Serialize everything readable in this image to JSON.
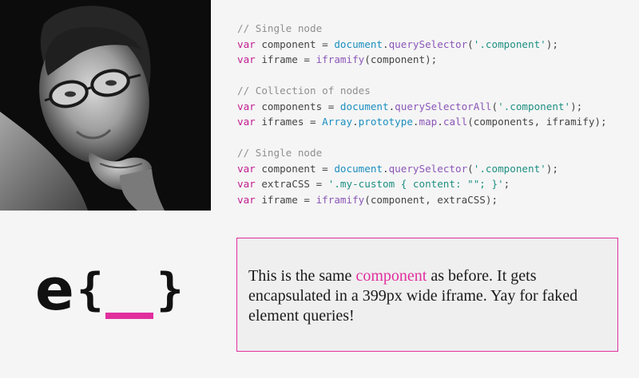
{
  "code": {
    "lines": [
      [
        {
          "t": "// Single node",
          "c": "comment"
        }
      ],
      [
        {
          "t": "var",
          "c": "keyword"
        },
        {
          "t": " component = ",
          "c": "plain"
        },
        {
          "t": "document",
          "c": "object"
        },
        {
          "t": ".",
          "c": "plain"
        },
        {
          "t": "querySelector",
          "c": "method"
        },
        {
          "t": "(",
          "c": "plain"
        },
        {
          "t": "'.component'",
          "c": "string"
        },
        {
          "t": ");",
          "c": "plain"
        }
      ],
      [
        {
          "t": "var",
          "c": "keyword"
        },
        {
          "t": " iframe = ",
          "c": "plain"
        },
        {
          "t": "iframify",
          "c": "method"
        },
        {
          "t": "(component);",
          "c": "plain"
        }
      ],
      [],
      [
        {
          "t": "// Collection of nodes",
          "c": "comment"
        }
      ],
      [
        {
          "t": "var",
          "c": "keyword"
        },
        {
          "t": " components = ",
          "c": "plain"
        },
        {
          "t": "document",
          "c": "object"
        },
        {
          "t": ".",
          "c": "plain"
        },
        {
          "t": "querySelectorAll",
          "c": "method"
        },
        {
          "t": "(",
          "c": "plain"
        },
        {
          "t": "'.component'",
          "c": "string"
        },
        {
          "t": ");",
          "c": "plain"
        }
      ],
      [
        {
          "t": "var",
          "c": "keyword"
        },
        {
          "t": " iframes = ",
          "c": "plain"
        },
        {
          "t": "Array",
          "c": "object"
        },
        {
          "t": ".",
          "c": "plain"
        },
        {
          "t": "prototype",
          "c": "object"
        },
        {
          "t": ".",
          "c": "plain"
        },
        {
          "t": "map",
          "c": "method"
        },
        {
          "t": ".",
          "c": "plain"
        },
        {
          "t": "call",
          "c": "method"
        },
        {
          "t": "(components, iframify);",
          "c": "plain"
        }
      ],
      [],
      [
        {
          "t": "// Single node",
          "c": "comment"
        }
      ],
      [
        {
          "t": "var",
          "c": "keyword"
        },
        {
          "t": " component = ",
          "c": "plain"
        },
        {
          "t": "document",
          "c": "object"
        },
        {
          "t": ".",
          "c": "plain"
        },
        {
          "t": "querySelector",
          "c": "method"
        },
        {
          "t": "(",
          "c": "plain"
        },
        {
          "t": "'.component'",
          "c": "string"
        },
        {
          "t": ");",
          "c": "plain"
        }
      ],
      [
        {
          "t": "var",
          "c": "keyword"
        },
        {
          "t": " extraCSS = ",
          "c": "plain"
        },
        {
          "t": "'.my-custom { content: \"\"; }'",
          "c": "string"
        },
        {
          "t": ";",
          "c": "plain"
        }
      ],
      [
        {
          "t": "var",
          "c": "keyword"
        },
        {
          "t": " iframe = ",
          "c": "plain"
        },
        {
          "t": "iframify",
          "c": "method"
        },
        {
          "t": "(component, extraCSS);",
          "c": "plain"
        }
      ]
    ]
  },
  "demo": {
    "before": "This is the same ",
    "highlight": "component",
    "after": " as before. It gets encapsulated in a 399px wide iframe. Yay for faked element queries!"
  },
  "colors": {
    "accent": "#e12f9e",
    "background": "#f5f5f5",
    "demo_background": "#efefef",
    "logo": "#111111"
  },
  "icons": {
    "logo": "e-curly-brace-logo",
    "photo": "speaker-portrait"
  }
}
